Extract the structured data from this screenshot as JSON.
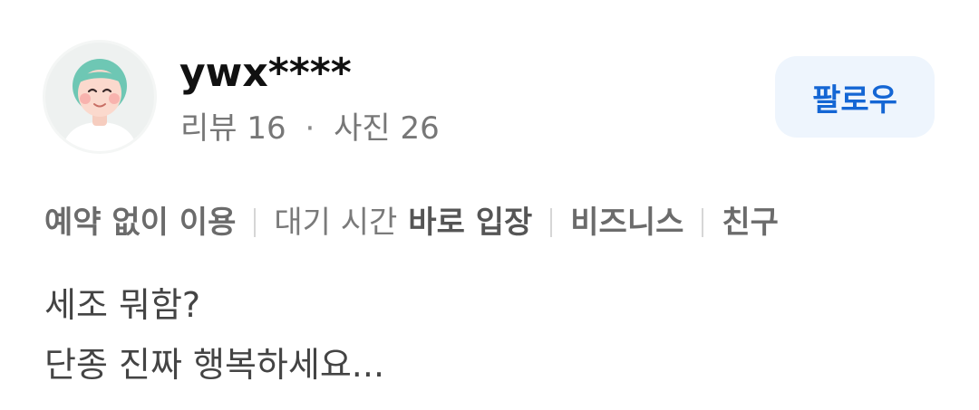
{
  "reviewer": {
    "username": "ywx****",
    "reviews_label": "리뷰",
    "reviews_count": "16",
    "separator": "·",
    "photos_label": "사진",
    "photos_count": "26",
    "avatar_icon": "avatar-illustration-icon"
  },
  "follow_button": {
    "label": "팔로우",
    "color": "#1466d4",
    "background": "#eef5fd"
  },
  "tags": {
    "reservation": "예약 없이 이용",
    "wait_time_label": "대기 시간",
    "wait_time_value": "바로 입장",
    "purpose": "비즈니스",
    "companion": "친구"
  },
  "review": {
    "line1": "세조 뭐함?",
    "line2": "단종 진짜 행복하세요..."
  }
}
